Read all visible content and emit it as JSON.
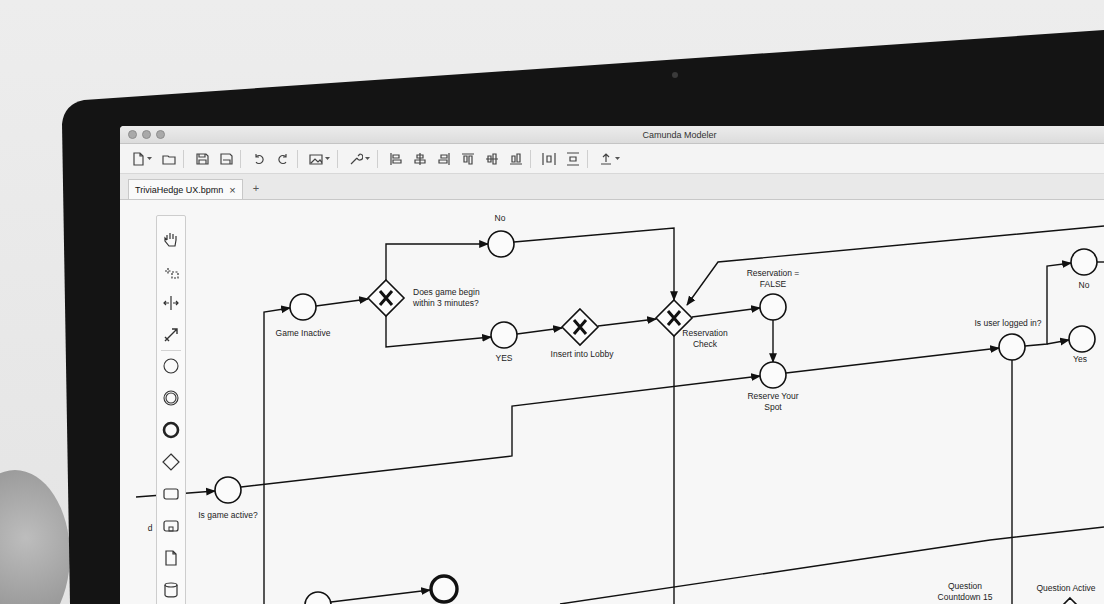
{
  "window": {
    "title": "Camunda Modeler"
  },
  "tabs": [
    {
      "label": "TriviaHedge UX.bpmn",
      "close": "×",
      "selected": true
    }
  ],
  "new_tab": "+",
  "diagram": {
    "nodes": [
      {
        "kind": "start",
        "label": [
          "Game Inactive"
        ]
      },
      {
        "kind": "gateway",
        "label": [
          "Does game begin",
          "within 3 minutes?"
        ]
      },
      {
        "kind": "start",
        "label": [
          "No"
        ]
      },
      {
        "kind": "start",
        "label": [
          "YES"
        ]
      },
      {
        "kind": "gateway",
        "label": [
          "Insert into Lobby"
        ]
      },
      {
        "kind": "gateway",
        "label": [
          "Reservation",
          "Check"
        ]
      },
      {
        "kind": "start",
        "label": [
          "Reservation =",
          "FALSE"
        ]
      },
      {
        "kind": "start",
        "label": [
          "Reserve Your",
          "Spot"
        ]
      },
      {
        "kind": "start",
        "label": [
          "Is user logged in?"
        ]
      },
      {
        "kind": "start",
        "label": [
          "No"
        ]
      },
      {
        "kind": "start",
        "label": [
          "Yes"
        ]
      },
      {
        "kind": "start",
        "label": [
          "Is game active?"
        ]
      },
      {
        "kind": "start",
        "label": []
      },
      {
        "kind": "end",
        "label": []
      },
      {
        "kind": "label",
        "label": [
          "Question",
          "Countdown 15"
        ]
      },
      {
        "kind": "diamond",
        "label": [
          "Question Active"
        ]
      },
      {
        "kind": "label",
        "label": [
          "d"
        ]
      }
    ]
  }
}
